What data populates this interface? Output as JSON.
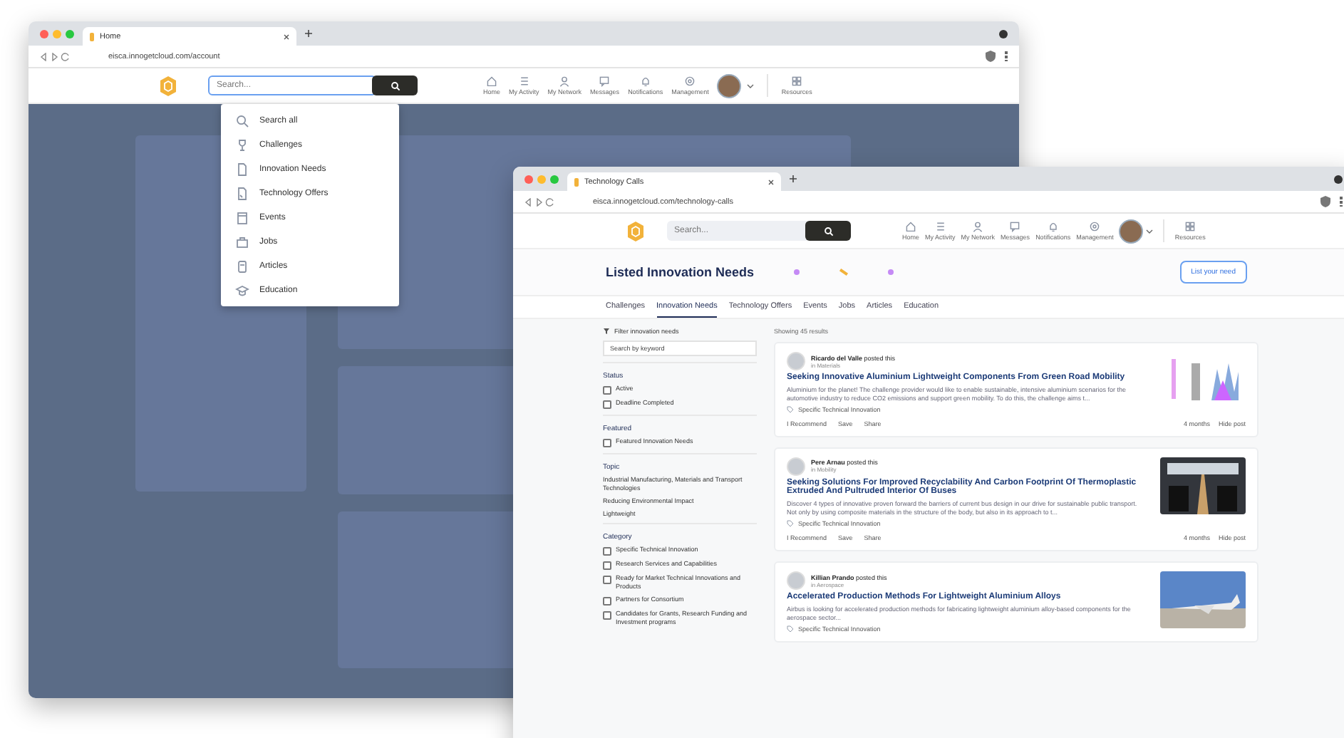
{
  "back_window": {
    "tab_title": "Home",
    "url": "eisca.innogetcloud.com/account",
    "header": {
      "search_placeholder": "Search...",
      "nav": [
        {
          "kind": "home",
          "label": "Home"
        },
        {
          "kind": "activity",
          "label": "My Activity"
        },
        {
          "kind": "network",
          "label": "My Network"
        },
        {
          "kind": "messages",
          "label": "Messages"
        },
        {
          "kind": "notifications",
          "label": "Notifications"
        },
        {
          "kind": "management",
          "label": "Management"
        }
      ],
      "resources_label": "Resources"
    },
    "search_dropdown": [
      {
        "kind": "search",
        "label": "Search all"
      },
      {
        "kind": "trophy",
        "label": "Challenges"
      },
      {
        "kind": "document",
        "label": "Innovation Needs"
      },
      {
        "kind": "offer",
        "label": "Technology Offers"
      },
      {
        "kind": "calendar",
        "label": "Events"
      },
      {
        "kind": "briefcase",
        "label": "Jobs"
      },
      {
        "kind": "article",
        "label": "Articles"
      },
      {
        "kind": "education",
        "label": "Education"
      }
    ]
  },
  "front_window": {
    "tab_title": "Technology Calls",
    "url": "eisca.innogetcloud.com/technology-calls",
    "header": {
      "search_placeholder": "Search...",
      "nav": [
        {
          "kind": "home",
          "label": "Home"
        },
        {
          "kind": "activity",
          "label": "My Activity"
        },
        {
          "kind": "network",
          "label": "My Network"
        },
        {
          "kind": "messages",
          "label": "Messages"
        },
        {
          "kind": "notifications",
          "label": "Notifications"
        },
        {
          "kind": "management",
          "label": "Management"
        }
      ],
      "resources_label": "Resources"
    },
    "page_title": "Listed Innovation Needs",
    "list_button": "List your need",
    "tabs": [
      {
        "label": "Challenges",
        "selected": false
      },
      {
        "label": "Innovation Needs",
        "selected": true
      },
      {
        "label": "Technology Offers",
        "selected": false
      },
      {
        "label": "Events",
        "selected": false
      },
      {
        "label": "Jobs",
        "selected": false
      },
      {
        "label": "Articles",
        "selected": false
      },
      {
        "label": "Education",
        "selected": false
      }
    ],
    "filters": {
      "heading": "Filter innovation needs",
      "search_placeholder": "Search by keyword",
      "sections": [
        {
          "kind": "checkboxes",
          "title": "Status",
          "items": [
            {
              "label": "Active",
              "checked": false
            },
            {
              "label": "Deadline Completed",
              "checked": false
            }
          ]
        },
        {
          "kind": "checkboxes",
          "title": "Featured",
          "items": [
            {
              "label": "Featured Innovation Needs",
              "checked": false
            }
          ]
        },
        {
          "kind": "links",
          "title": "Topic",
          "items": [
            {
              "label": "Industrial Manufacturing, Materials and Transport Technologies"
            },
            {
              "label": "Reducing Environmental Impact"
            },
            {
              "label": "Lightweight"
            }
          ]
        },
        {
          "kind": "checkboxes",
          "title": "Category",
          "items": [
            {
              "label": "Specific Technical Innovation",
              "checked": false
            },
            {
              "label": "Research Services and Capabilities",
              "checked": false
            },
            {
              "label": "Ready for Market Technical Innovations and Products",
              "checked": false
            },
            {
              "label": "Partners for Consortium",
              "checked": false
            },
            {
              "label": "Candidates for Grants, Research Funding and Investment programs",
              "checked": false
            }
          ]
        }
      ]
    },
    "results_label": "Showing 45 results",
    "posts": [
      {
        "author": "Ricardo del Valle",
        "posted": "posted this",
        "field": "in Materials",
        "title": "Seeking Innovative Aluminium Lightweight Components From Green Road Mobility",
        "description": "Aluminium for the planet! The challenge provider would like to enable sustainable, intensive aluminium scenarios for the automotive industry to reduce CO2 emissions and support green mobility. To do this, the challenge aims t...",
        "tag": "Specific Technical Innovation",
        "actions": [
          "I Recommend",
          "Save",
          "Share"
        ],
        "age": "4 months",
        "hide": "Hide post"
      },
      {
        "author": "Pere Arnau",
        "posted": "posted this",
        "field": "in Mobility",
        "title": "Seeking Solutions For Improved Recyclability And Carbon Footprint Of Thermoplastic Extruded And Pultruded Interior Of Buses",
        "description": "Discover 4 types of innovative proven forward the barriers of current bus design in our drive for sustainable public transport. Not only by using composite materials in the structure of the body, but also in its approach to t...",
        "tag": "Specific Technical Innovation",
        "actions": [
          "I Recommend",
          "Save",
          "Share"
        ],
        "age": "4 months",
        "hide": "Hide post"
      },
      {
        "author": "Killian Prando",
        "posted": "posted this",
        "field": "in Aerospace",
        "title": "Accelerated Production Methods For Lightweight Aluminium Alloys",
        "description": "Airbus is looking for accelerated production methods for fabricating lightweight aluminium alloy-based components for the aerospace sector...",
        "tag": "Specific Technical Innovation"
      }
    ]
  }
}
